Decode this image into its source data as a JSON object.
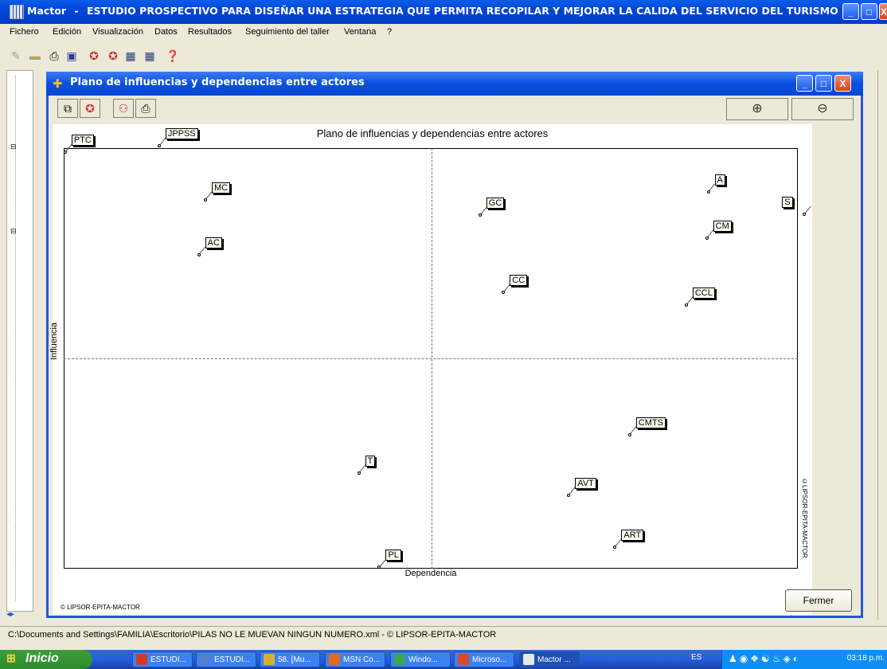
{
  "window": {
    "app": "Mactor",
    "separator": "-",
    "title": "ESTUDIO PROSPECTIVO PARA DISEÑAR UNA ESTRATEGIA QUE PERMITA RECOPILAR Y MEJORAR LA CALIDA DEL SERVICIO  DEL TURISMO HIST...",
    "controls": [
      "_",
      "□",
      "X"
    ]
  },
  "menu": [
    "Fichero",
    "Edición",
    "Visualización",
    "Datos",
    "Resultados",
    "Seguimiento del taller",
    "Ventana",
    "?"
  ],
  "toolbar_icons": [
    "open-icon",
    "folder-icon",
    "print-icon",
    "save-icon",
    "actor-icon",
    "actor-icon-2",
    "table-icon",
    "table-icon-2",
    "help-icon"
  ],
  "child": {
    "title": "Plano de influencias y dependencias entre actores",
    "zoom_in": "⊕",
    "zoom_out": "⊖",
    "close_button": "Fermer",
    "copyright_bottom": "© LIPSOR-EPITA-MACTOR",
    "copyright_side": "©LIPSOR-EPITA-MACTOR"
  },
  "chart_data": {
    "type": "scatter",
    "title": "Plano de influencias y dependencias entre actores",
    "xlabel": "Dependencia",
    "ylabel": "Influencia",
    "axes_units": "relative (0 = left/bottom edge, 100 = right/top edge of frame)",
    "grid": "dashed midlines",
    "points": [
      {
        "label": "PTC",
        "x": 0.2,
        "y": 99.0
      },
      {
        "label": "JPPSS",
        "x": 13.0,
        "y": 100.5
      },
      {
        "label": "MC",
        "x": 19.3,
        "y": 87.7
      },
      {
        "label": "AC",
        "x": 18.4,
        "y": 74.6
      },
      {
        "label": "GC",
        "x": 56.7,
        "y": 84.0
      },
      {
        "label": "A",
        "x": 87.8,
        "y": 89.6
      },
      {
        "label": "S",
        "x": 100.9,
        "y": 84.3
      },
      {
        "label": "CM",
        "x": 87.6,
        "y": 78.6
      },
      {
        "label": "CC",
        "x": 59.9,
        "y": 65.7
      },
      {
        "label": "CCL",
        "x": 84.8,
        "y": 62.7
      },
      {
        "label": "CMTS",
        "x": 77.1,
        "y": 31.9
      },
      {
        "label": "T",
        "x": 40.2,
        "y": 22.7
      },
      {
        "label": "AVT",
        "x": 68.8,
        "y": 17.5
      },
      {
        "label": "ART",
        "x": 75.1,
        "y": 5.2
      },
      {
        "label": "PL",
        "x": 43.0,
        "y": 0.3
      }
    ]
  },
  "status": "C:\\Documents and Settings\\FAMILIA\\Escritorio\\PILAS NO LE MUEVAN NINGUN NUMERO.xml  - © LIPSOR-EPITA-MACTOR",
  "taskbar": {
    "start": "Inicio",
    "tasks": [
      "ESTUDI...",
      "ESTUDI...",
      "58. [Mu...",
      "MSN Co...",
      "Windo...",
      "Microso...",
      "Mactor ..."
    ],
    "task_colors": [
      "#d03a2a",
      "#5a7ccf",
      "#d8b030",
      "#e26b1f",
      "#3aa850",
      "#d84a2a",
      "#e8e8e8"
    ],
    "lang": "ES",
    "clock": "03:18 p.m."
  }
}
